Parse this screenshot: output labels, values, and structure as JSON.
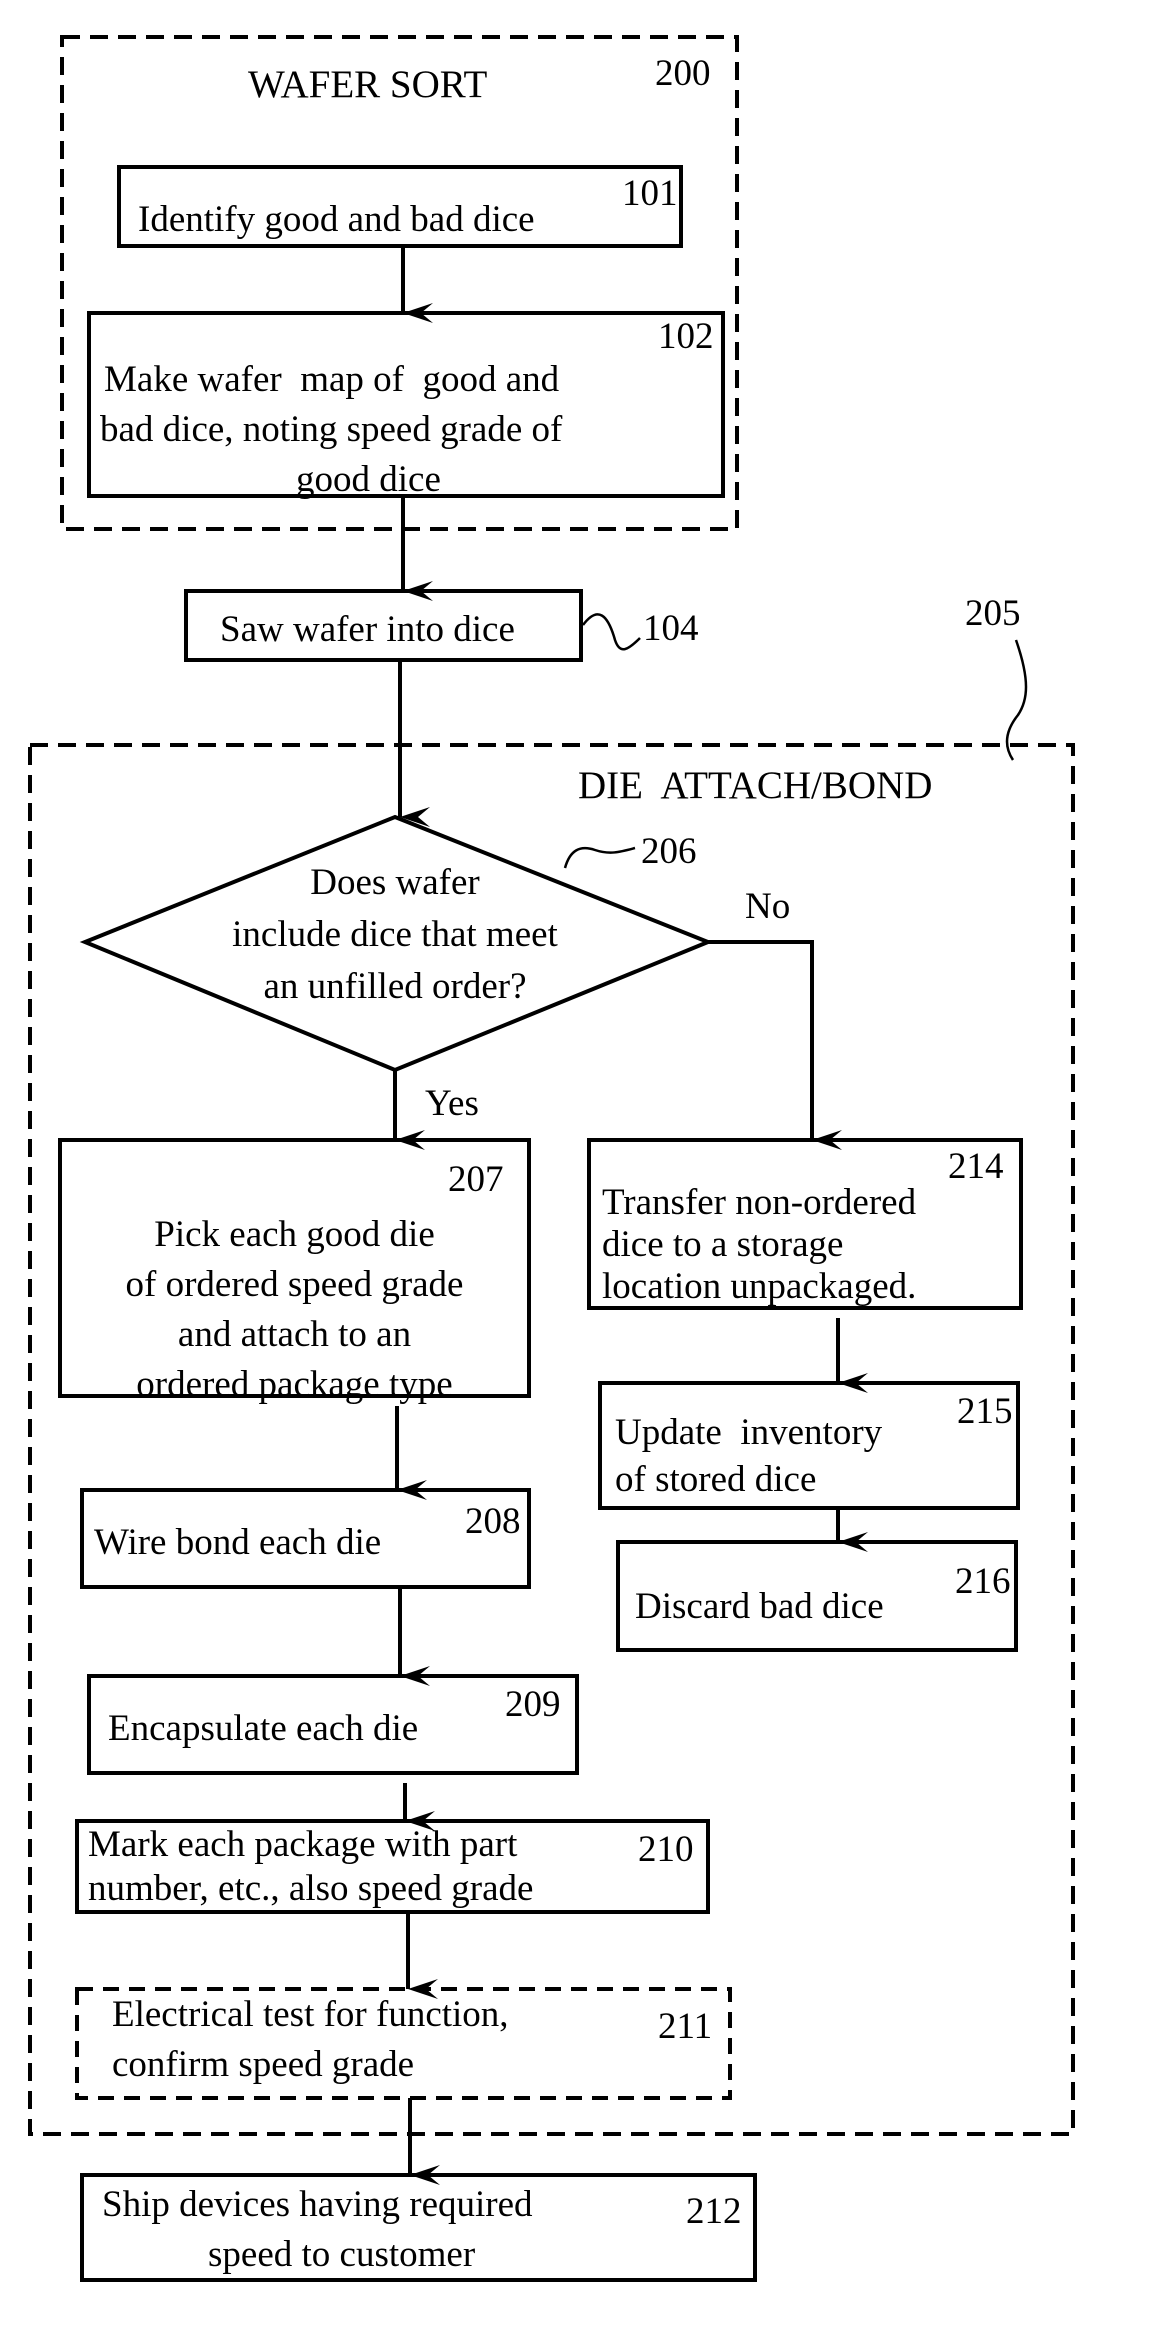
{
  "groups": {
    "wafer_sort": {
      "title": "WAFER SORT",
      "ref": "200"
    },
    "die_attach": {
      "title": "DIE  ATTACH/BOND",
      "ref": "205"
    }
  },
  "steps": {
    "s101": {
      "ref": "101",
      "lines": [
        "Identify good and bad dice"
      ]
    },
    "s102": {
      "ref": "102",
      "lines": [
        "Make wafer  map of  good and",
        "bad dice, noting speed grade of",
        "good dice"
      ]
    },
    "s104": {
      "ref": "104",
      "lines": [
        "Saw wafer into dice"
      ]
    },
    "s206": {
      "ref": "206",
      "lines": [
        "Does wafer",
        "include dice that meet",
        "an unfilled order?"
      ]
    },
    "s207": {
      "ref": "207",
      "lines": [
        "Pick each good die",
        "of ordered speed grade",
        "and attach to an",
        "ordered package type"
      ]
    },
    "s208": {
      "ref": "208",
      "lines": [
        "Wire bond each die"
      ]
    },
    "s209": {
      "ref": "209",
      "lines": [
        "Encapsulate each die"
      ]
    },
    "s210": {
      "ref": "210",
      "lines": [
        "Mark each package with part",
        "number, etc., also speed grade"
      ]
    },
    "s211": {
      "ref": "211",
      "lines": [
        "Electrical test for function,",
        "confirm speed grade"
      ]
    },
    "s212": {
      "ref": "212",
      "lines": [
        "Ship devices having required",
        "speed to customer"
      ]
    },
    "s214": {
      "ref": "214",
      "lines": [
        "Transfer non-ordered",
        "dice to a storage",
        "location unpackaged."
      ]
    },
    "s215": {
      "ref": "215",
      "lines": [
        "Update  inventory",
        "of stored dice"
      ]
    },
    "s216": {
      "ref": "216",
      "lines": [
        "Discard bad dice"
      ]
    }
  },
  "branches": {
    "yes": "Yes",
    "no": "No"
  }
}
